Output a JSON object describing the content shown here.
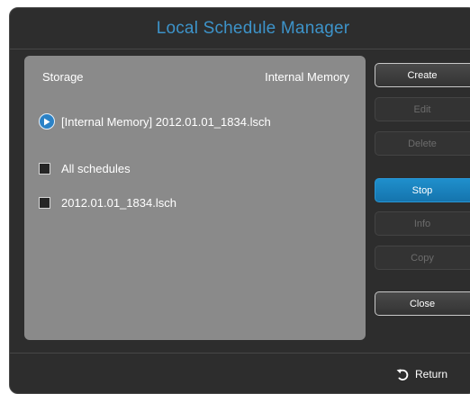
{
  "window": {
    "title": "Local Schedule Manager"
  },
  "storage": {
    "label": "Storage",
    "value": "Internal Memory"
  },
  "current_file": {
    "label": "[Internal Memory] 2012.01.01_1834.lsch",
    "icon": "play-icon"
  },
  "schedules": [
    {
      "label": "All schedules",
      "checked": false
    },
    {
      "label": "2012.01.01_1834.lsch",
      "checked": false
    }
  ],
  "actions": {
    "create": {
      "label": "Create",
      "state": "enabled"
    },
    "edit": {
      "label": "Edit",
      "state": "disabled"
    },
    "delete": {
      "label": "Delete",
      "state": "disabled"
    },
    "stop": {
      "label": "Stop",
      "state": "selected"
    },
    "info": {
      "label": "Info",
      "state": "disabled"
    },
    "copy": {
      "label": "Copy",
      "state": "disabled"
    },
    "close": {
      "label": "Close",
      "state": "enabled"
    }
  },
  "footer": {
    "return_label": "Return",
    "return_icon": "return-arrow-icon"
  },
  "colors": {
    "title": "#3d93c9",
    "accent": "#1f8fcc",
    "panel": "#8a8a8a",
    "background": "#2d2d2d"
  }
}
